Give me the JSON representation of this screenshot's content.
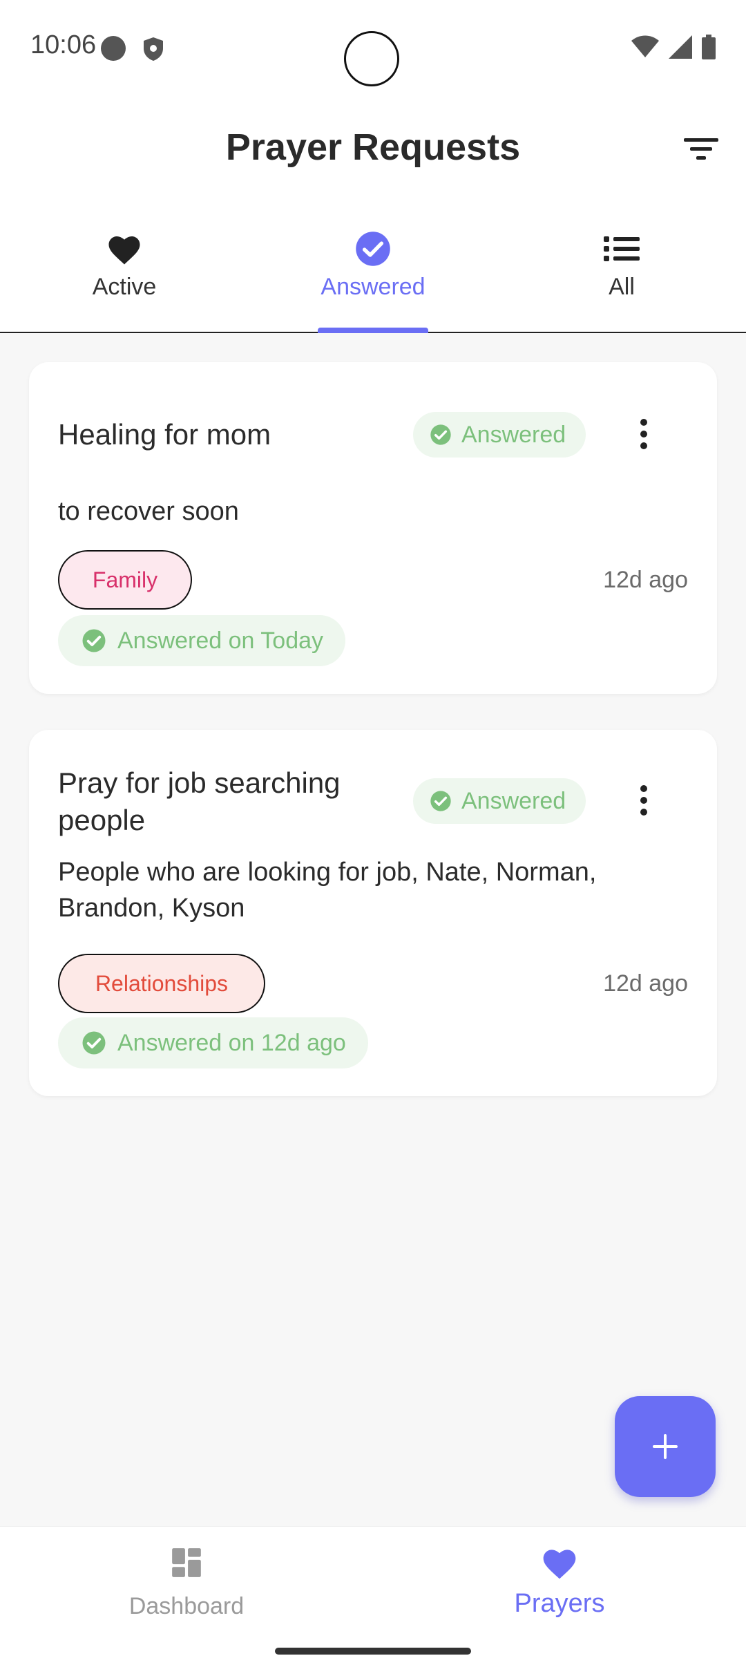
{
  "status_bar": {
    "time": "10:06",
    "icons": [
      "circle-notification-icon",
      "shield-icon",
      "wifi-icon",
      "signal-icon",
      "battery-icon"
    ]
  },
  "header": {
    "title": "Prayer Requests",
    "filter_icon": "filter-icon"
  },
  "tabs": [
    {
      "label": "Active",
      "icon": "heart-icon",
      "selected": false
    },
    {
      "label": "Answered",
      "icon": "check-circle-icon",
      "selected": true
    },
    {
      "label": "All",
      "icon": "list-icon",
      "selected": false
    }
  ],
  "cards": [
    {
      "title": "Healing for mom",
      "status_badge": "Answered",
      "description": "to recover soon",
      "category": "Family",
      "time_ago": "12d ago",
      "answered_on": "Answered on Today"
    },
    {
      "title": "Pray for job searching people",
      "status_badge": "Answered",
      "description": "People who are looking for job, Nate, Norman, Brandon, Kyson",
      "category": "Relationships",
      "time_ago": "12d ago",
      "answered_on": "Answered on 12d ago"
    }
  ],
  "fab": {
    "icon": "plus-icon"
  },
  "bottom_nav": [
    {
      "label": "Dashboard",
      "icon": "dashboard-icon",
      "selected": false
    },
    {
      "label": "Prayers",
      "icon": "heart-icon",
      "selected": true
    }
  ],
  "colors": {
    "accent": "#6a6ef4",
    "answered_green": "#7cc07c",
    "family_chip": "#d8306a",
    "relationships_chip": "#e24b3b"
  }
}
